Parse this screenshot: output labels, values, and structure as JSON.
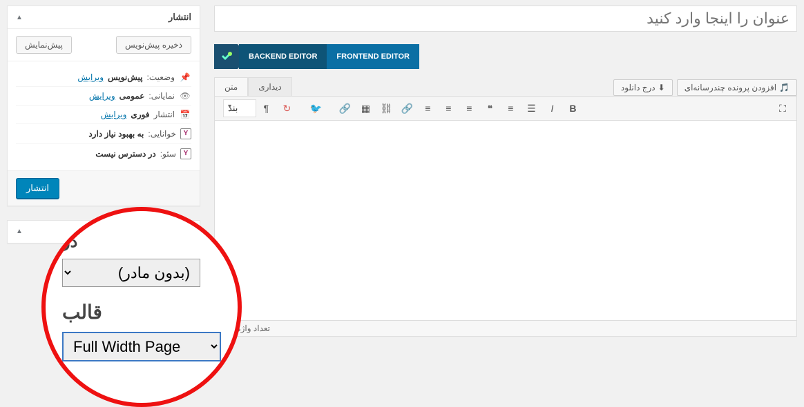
{
  "title_placeholder": "عنوان را اینجا وارد کنید",
  "vc": {
    "backend": "BACKEND EDITOR",
    "frontend": "FRONTEND EDITOR"
  },
  "media": {
    "add": "افزودن پرونده چندرسانه‌ای",
    "download": "درج دانلود"
  },
  "editor_tabs": {
    "visual": "دیداری",
    "text": "متن"
  },
  "block_dropdown": "بند",
  "word_count": "تعداد واژه‌ها: 0",
  "publish_panel": {
    "title": "انتشار",
    "save_draft": "ذخیره پیش‌نویس",
    "preview": "پیش‌نمایش",
    "status_label": "وضعیت:",
    "status_value": "پیش‌نویس",
    "visibility_label": "نمایانی:",
    "visibility_value": "عمومی",
    "schedule_label": "انتشار",
    "schedule_value": "فوری",
    "edit": "ویرایش",
    "readability_label": "خوانایی:",
    "readability_value": "به بهبود نیاز دارد",
    "seo_label": "سئو:",
    "seo_value": "در دسترس نیست",
    "publish_btn": "انتشار"
  },
  "zoom": {
    "fragment": "در",
    "parent_option": "(بدون مادر)",
    "template_label": "قالب",
    "template_option": "Full Width Page"
  }
}
